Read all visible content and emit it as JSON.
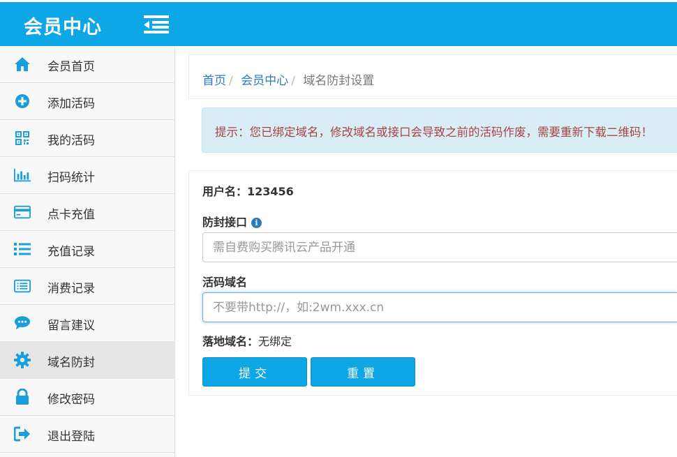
{
  "header": {
    "brand": "会员中心",
    "menu_icon": "outdent-icon",
    "color": "#0ea7e6"
  },
  "sidebar": {
    "items": [
      {
        "label": "会员首页",
        "icon": "home-icon"
      },
      {
        "label": "添加活码",
        "icon": "plus-circle-icon"
      },
      {
        "label": "我的活码",
        "icon": "qrcode-icon"
      },
      {
        "label": "扫码统计",
        "icon": "bar-chart-icon"
      },
      {
        "label": "点卡充值",
        "icon": "credit-card-icon"
      },
      {
        "label": "充值记录",
        "icon": "list-icon"
      },
      {
        "label": "消费记录",
        "icon": "list-alt-icon"
      },
      {
        "label": "留言建议",
        "icon": "comment-icon"
      },
      {
        "label": "域名防封",
        "icon": "gear-icon",
        "active": true
      },
      {
        "label": "修改密码",
        "icon": "lock-icon"
      },
      {
        "label": "退出登陆",
        "icon": "sign-out-icon"
      }
    ]
  },
  "breadcrumb": {
    "home": "首页",
    "member": "会员中心",
    "current": "域名防封设置"
  },
  "alert": {
    "text": "提示：您已绑定域名，修改域名或接口会导致之前的活码作废，需要重新下载二维码！"
  },
  "form": {
    "username_label": "用户名：",
    "username_value": "123456",
    "api_label": "防封接口",
    "api_placeholder": "需自费购买腾讯云产品开通",
    "domain_label": "活码域名",
    "domain_placeholder": "不要带http://，如:2wm.xxx.cn",
    "landing_label": "落地域名：",
    "landing_value": "无绑定",
    "submit_label": "提交",
    "reset_label": "重置"
  }
}
